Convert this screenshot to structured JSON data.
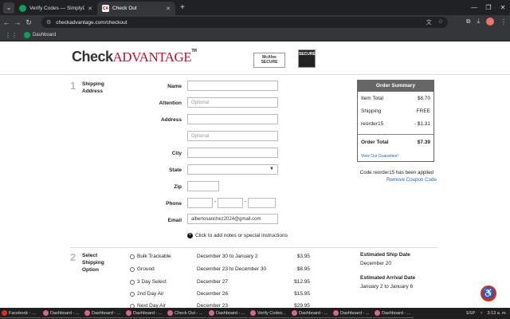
{
  "browser": {
    "tabs": [
      {
        "title": "Verify Codes — SimplyCodes",
        "active": false
      },
      {
        "title": "Check Out",
        "active": true
      }
    ],
    "url": "checkadvantage.com/checkout",
    "bookmark": "Dashboard"
  },
  "site": {
    "logo_check": "Check",
    "logo_advantage": "Advantage",
    "logo_tm": "TM",
    "mcafee_line1": "McAfee",
    "mcafee_line2": "SECURE",
    "secure_badge": "SECURE"
  },
  "step1": {
    "number": "1",
    "title": "Shipping Address",
    "fields": {
      "name_label": "Name",
      "attention_label": "Attention",
      "attention_placeholder": "Optional",
      "address_label": "Address",
      "address2_placeholder": "Optional",
      "city_label": "City",
      "state_label": "State",
      "zip_label": "Zip",
      "phone_label": "Phone",
      "phone_sep": "-",
      "email_label": "Email",
      "email_value": "albertosanchez2024@gmail.com"
    },
    "notes_link": "Click to add notes or special instructions"
  },
  "summary": {
    "header": "Order Summary",
    "item_total_label": "Item Total",
    "item_total_value": "$8.70",
    "shipping_label": "Shipping",
    "shipping_value": "FREE",
    "discount_label": "reorder15",
    "discount_value": "- $1.31",
    "order_total_label": "Order Total",
    "order_total_value": "$7.39",
    "guarantee_link": "View Our Guarantee!",
    "coupon_note": "Code reorder15 has been applied",
    "remove_coupon": "Remove Coupon Code"
  },
  "step2": {
    "number": "2",
    "title": "Select Shipping Option",
    "options": [
      {
        "name": "Bulk Trackable",
        "date": "December 30 to January 2",
        "price": "$3.95"
      },
      {
        "name": "Ground",
        "date": "December 23 to December 30",
        "price": "$8.95"
      },
      {
        "name": "3 Day Select",
        "date": "December 27",
        "price": "$12.95"
      },
      {
        "name": "2nd Day Air",
        "date": "December 26",
        "price": "$15.95"
      },
      {
        "name": "Next Day Air",
        "date": "December 23",
        "price": "$29.95"
      }
    ],
    "est_ship_label": "Estimated Ship Date",
    "est_ship_value": "December 20",
    "est_arrival_label": "Estimated Arrival Date",
    "est_arrival_value": "January 2 to January 6"
  },
  "taskbar": {
    "items": [
      "Facebook - ...",
      "Dashboard - ...",
      "Dashboard - ...",
      "Dashboard - ...",
      "Check Out - ...",
      "Dashboard - ...",
      "Verify Codes...",
      "Dashboard - ...",
      "Dashboard - ...",
      "Dashboard - ..."
    ],
    "lang": "ESP",
    "time": "3:13 a. m."
  }
}
